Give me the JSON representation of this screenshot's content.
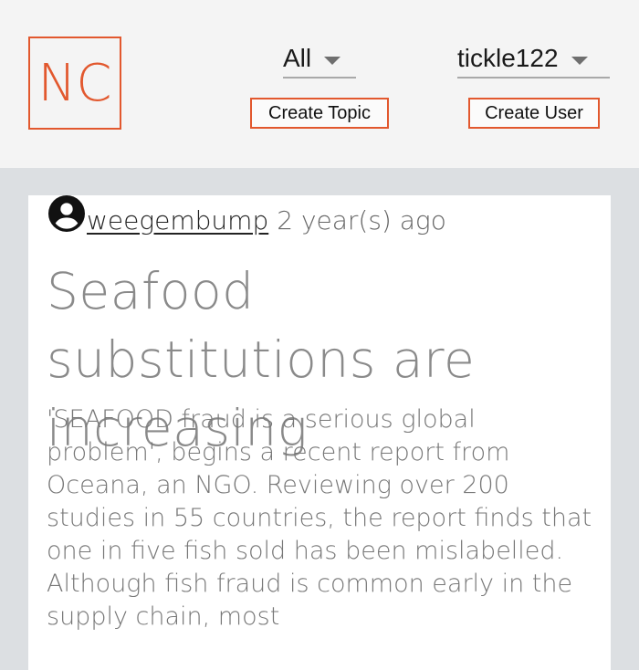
{
  "header": {
    "logo_text": "NC",
    "topic_select": {
      "value": "All"
    },
    "user_select": {
      "value": "tickle122"
    },
    "create_topic_label": "Create Topic",
    "create_user_label": "Create User"
  },
  "article": {
    "author": "weegembump",
    "posted": "2 year(s) ago",
    "title": "Seafood substitutions are increasing",
    "body": "'SEAFOOD fraud is a serious global problem', begins a recent report from Oceana, an NGO. Reviewing over 200 studies in 55 countries, the report finds that one in five fish sold has been mislabelled. Although fish fraud is common early in the supply chain, most"
  },
  "colors": {
    "accent": "#e2582e",
    "page_bg": "#dcdfe2",
    "header_bg": "#f4f4f4"
  },
  "icons": {
    "avatar": "account-circle-icon",
    "caret": "caret-down-icon"
  }
}
